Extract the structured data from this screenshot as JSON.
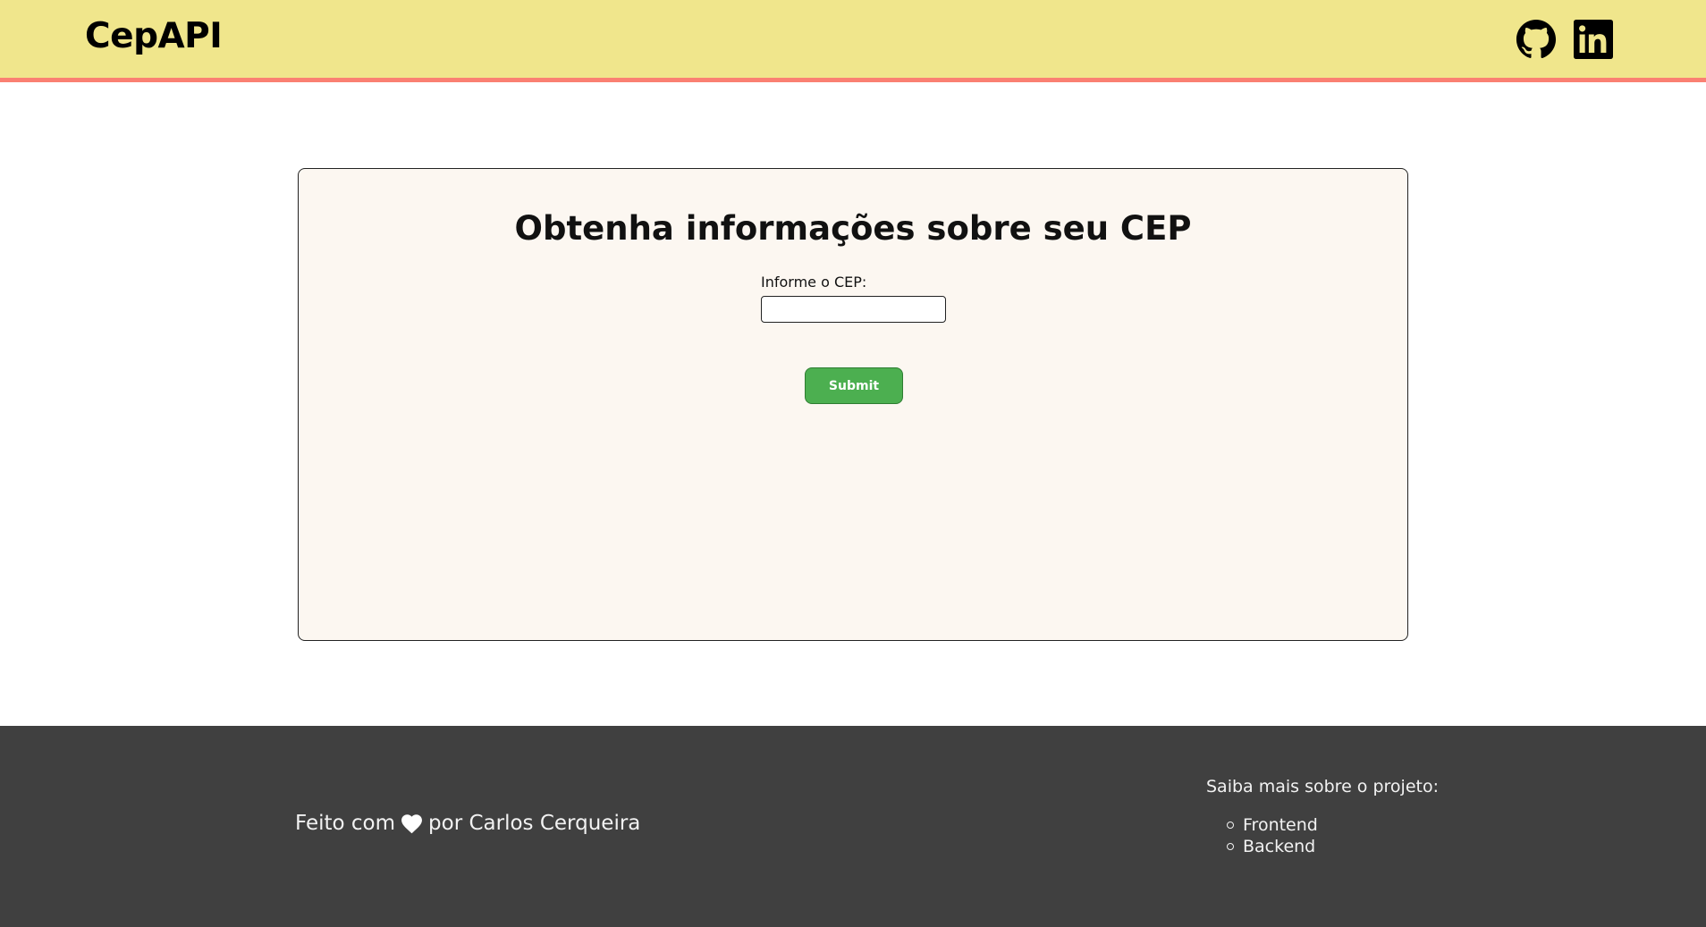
{
  "header": {
    "brand": "CepAPI",
    "social": [
      {
        "icon": "github-icon"
      },
      {
        "icon": "linkedin-icon"
      }
    ]
  },
  "main": {
    "title": "Obtenha informações sobre seu CEP",
    "cep_label": "Informe o CEP:",
    "cep_value": "",
    "submit_label": "Submit"
  },
  "footer": {
    "made_with_prefix": "Feito com",
    "made_with_icon": "heart-icon",
    "made_with_suffix": "por Carlos Cerqueira",
    "more_info": "Saiba mais sobre o projeto:",
    "links": [
      "Frontend",
      "Backend"
    ]
  },
  "colors": {
    "header_bg": "#f0e68c",
    "header_border": "#fa8072",
    "card_bg": "#fcf7f1",
    "submit_bg": "#4caf50",
    "footer_bg": "#404040"
  }
}
